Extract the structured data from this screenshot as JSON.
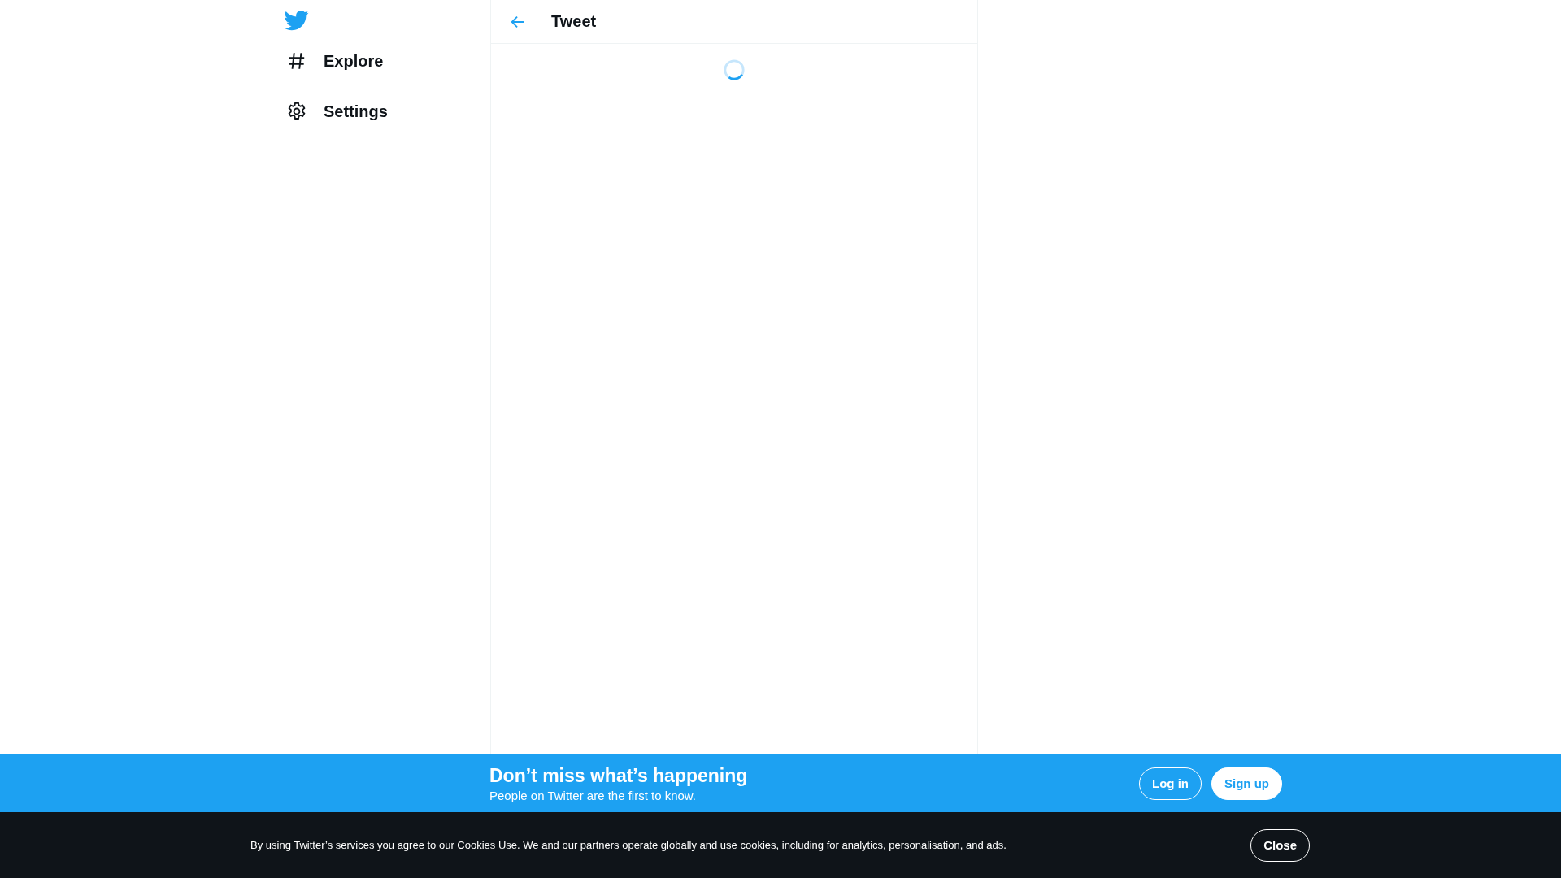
{
  "nav": [
    {
      "kind": "explore",
      "label": "Explore"
    },
    {
      "kind": "settings",
      "label": "Settings"
    }
  ],
  "header": {
    "title": "Tweet"
  },
  "banner": {
    "title": "Don’t miss what’s happening",
    "subtitle": "People on Twitter are the first to know.",
    "buttons": [
      {
        "kind": "outline",
        "label": "Log in"
      },
      {
        "kind": "filled",
        "label": "Sign up"
      }
    ]
  },
  "cookie_bar": {
    "text_before": "By using Twitter’s services you agree to our ",
    "link": "Cookies Use",
    "text_after": ". We and our partners operate globally and use cookies, including for analytics, personalisation, and ads.",
    "button": "Close"
  }
}
